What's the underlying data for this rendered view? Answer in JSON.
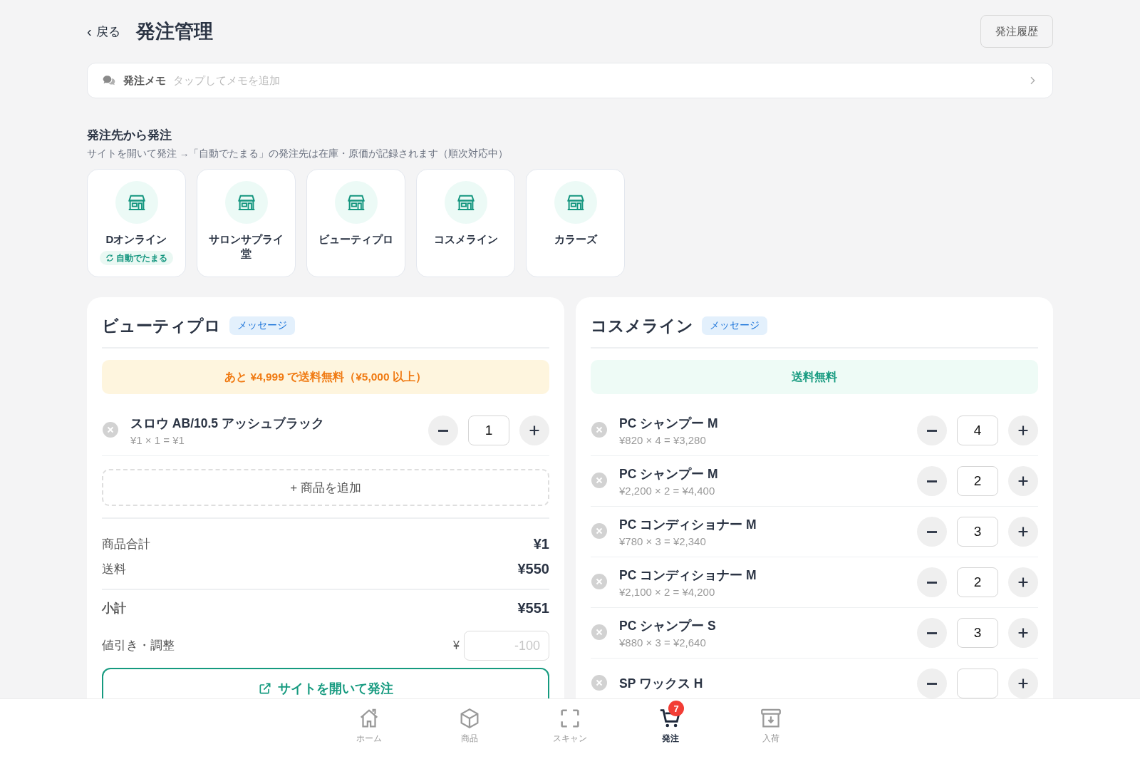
{
  "header": {
    "back_icon": "‹",
    "back": "戻る",
    "title": "発注管理",
    "history_button": "発注履歴"
  },
  "memo": {
    "label": "発注メモ",
    "placeholder": "タップしてメモを追加"
  },
  "suppliers_section": {
    "title": "発注先から発注",
    "note": "サイトを開いて発注 →「自動でたまる」の発注先は在庫・原価が記録されます（順次対応中）",
    "suppliers": [
      {
        "name": "Dオンライン",
        "badge": "自動でたまる"
      },
      {
        "name": "サロンサプライ堂"
      },
      {
        "name": "ビューティプロ"
      },
      {
        "name": "コスメライン"
      },
      {
        "name": "カラーズ"
      }
    ]
  },
  "orders": [
    {
      "supplier": "ビューティプロ",
      "message": "メッセージ",
      "notice": {
        "kind": "remaining",
        "text": "あと ¥4,999 で送料無料（¥5,000 以上）"
      },
      "items": [
        {
          "name": "スロウ AB/10.5 アッシュブラック",
          "detail": "¥1 × 1 = ¥1",
          "qty": "1"
        }
      ],
      "add_item": "+ 商品を追加",
      "summary": [
        {
          "label": "商品合計",
          "value": "¥1"
        },
        {
          "label": "送料",
          "value": "¥550"
        }
      ],
      "subtotal": {
        "label": "小計",
        "value": "¥551"
      },
      "discount": {
        "label": "値引き・調整",
        "currency": "¥",
        "placeholder": "-100"
      },
      "open_site": "サイトを開いて発注"
    },
    {
      "supplier": "コスメライン",
      "message": "メッセージ",
      "notice": {
        "kind": "free",
        "text": "送料無料"
      },
      "items": [
        {
          "name": "PC シャンプー M",
          "detail": "¥820 × 4 = ¥3,280",
          "qty": "4"
        },
        {
          "name": "PC シャンプー M",
          "detail": "¥2,200 × 2 = ¥4,400",
          "qty": "2"
        },
        {
          "name": "PC コンディショナー M",
          "detail": "¥780 × 3 = ¥2,340",
          "qty": "3"
        },
        {
          "name": "PC コンディショナー M",
          "detail": "¥2,100 × 2 = ¥4,200",
          "qty": "2"
        },
        {
          "name": "PC シャンプー S",
          "detail": "¥880 × 3 = ¥2,640",
          "qty": "3"
        },
        {
          "name": "SP ワックス H"
        }
      ]
    }
  ],
  "nav": {
    "items": [
      {
        "kind": "home",
        "label": "ホーム",
        "selected": false
      },
      {
        "kind": "product",
        "label": "商品",
        "selected": false
      },
      {
        "kind": "scan",
        "label": "スキャン",
        "selected": false
      },
      {
        "kind": "order",
        "label": "発注",
        "selected": true,
        "badge": "7"
      },
      {
        "kind": "receive",
        "label": "入荷",
        "selected": false
      }
    ]
  }
}
